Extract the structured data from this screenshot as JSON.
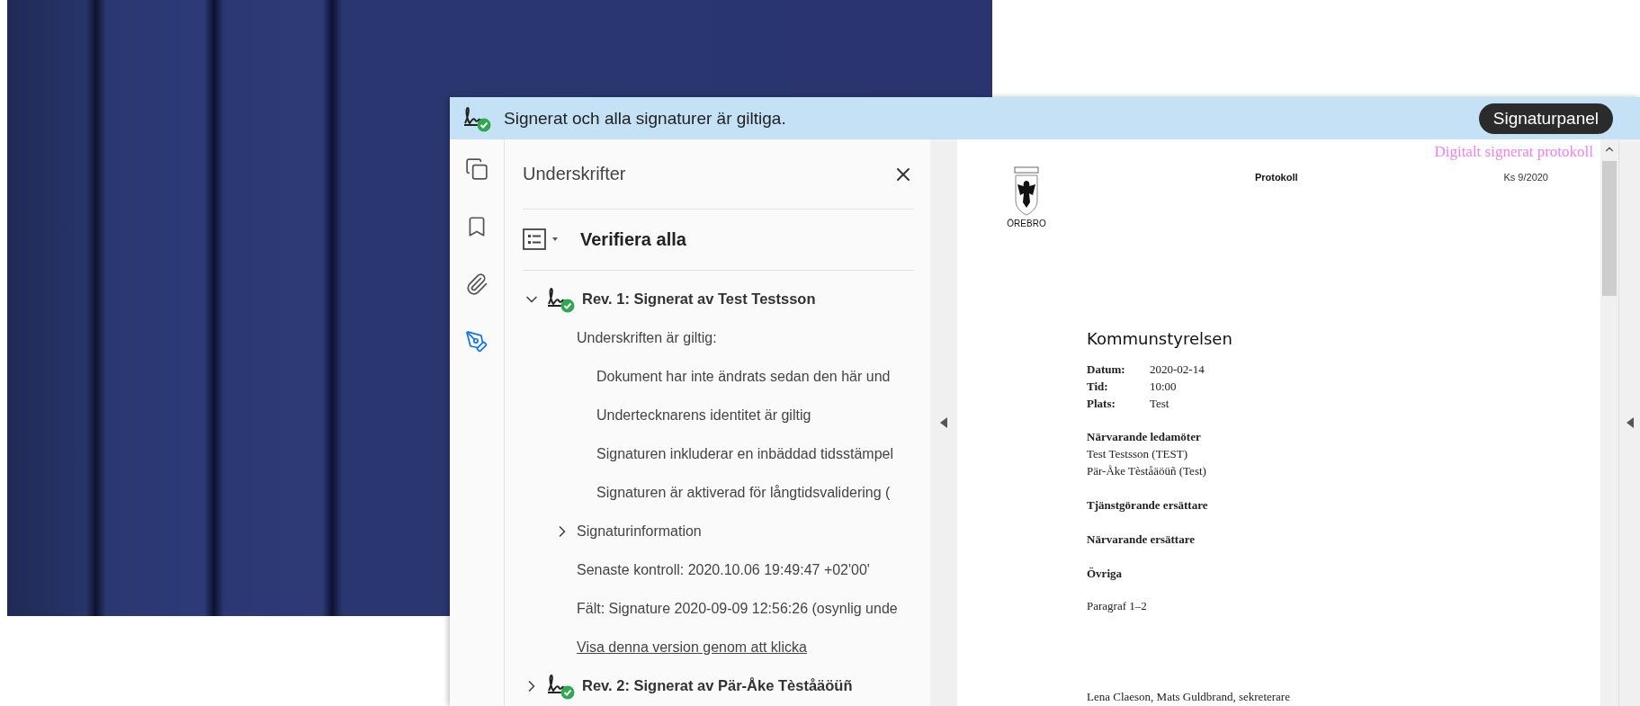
{
  "banner": {
    "message": "Signerat och alla signaturer är giltiga.",
    "button": "Signaturpanel"
  },
  "rail": [
    {
      "kind": "pages",
      "selected": false
    },
    {
      "kind": "bookmark",
      "selected": false
    },
    {
      "kind": "attachment",
      "selected": false
    },
    {
      "kind": "signature",
      "selected": true
    }
  ],
  "panel": {
    "title": "Underskrifter",
    "action": "Verifiera alla",
    "revisions": [
      {
        "label": "Rev. 1: Signerat av Test Testsson",
        "expanded": true,
        "status": "Underskriften är giltig:",
        "checks": [
          "Dokument har inte ändrats sedan den här und",
          "Undertecknarens identitet är giltig",
          "Signaturen inkluderar en inbäddad tidsstämpel",
          "Signaturen är aktiverad för långtidsvalidering ("
        ],
        "details": {
          "label": "Signaturinformation",
          "expanded": false
        },
        "last_check": "Senaste kontroll: 2020.10.06 19:49:47 +02'00'",
        "field": "Fält: Signature 2020-09-09 12:56:26 (osynlig unde",
        "link": "Visa denna version genom att klicka"
      },
      {
        "label": "Rev. 2: Signerat av Pär-Åke Tèståäöüñ",
        "expanded": false
      }
    ]
  },
  "document": {
    "stamp": "Digitalt signerat protokoll",
    "logo_text": "ÖREBRO",
    "doc_type": "Protokoll",
    "ref": "Ks 9/2020",
    "heading": "Kommunstyrelsen",
    "meta": [
      {
        "label": "Datum:",
        "value": "2020-02-14"
      },
      {
        "label": "Tid:",
        "value": "10:00"
      },
      {
        "label": "Plats:",
        "value": "Test"
      }
    ],
    "sections": [
      {
        "heading": "Närvarande ledamöter",
        "lines": [
          "Test Testsson (TEST)",
          "Pär-Åke Tèståäöüñ (Test)"
        ]
      },
      {
        "heading": "Tjänstgörande ersättare"
      },
      {
        "heading": "Närvarande ersättare"
      },
      {
        "heading": "Övriga"
      }
    ],
    "paragraphs": "Paragraf 1–2",
    "footer": "Lena Claeson, Mats Guldbrand, sekreterare"
  }
}
